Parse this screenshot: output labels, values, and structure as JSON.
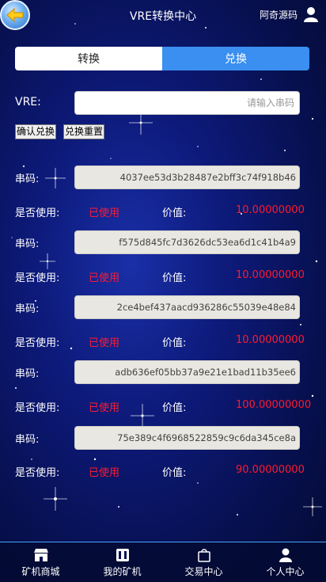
{
  "header": {
    "title": "VRE转换中心",
    "user_label": "阿奇源码"
  },
  "segment": {
    "tab_convert": "转换",
    "tab_redeem": "兑换"
  },
  "redeem_form": {
    "label": "VRE:",
    "placeholder": "请输入串码",
    "confirm_label": "确认兑换",
    "reset_label": "兑换重置"
  },
  "codes": [
    {
      "code_label": "串码:",
      "code": "4037ee53d3b28487e2bff3c74f918b46",
      "used_label": "是否使用:",
      "used": "已使用",
      "value_label": "价值:",
      "value": "10.00000000"
    },
    {
      "code_label": "串码:",
      "code": "f575d845fc7d3626dc53ea6d1c41b4a9",
      "used_label": "是否使用:",
      "used": "已使用",
      "value_label": "价值:",
      "value": "10.00000000"
    },
    {
      "code_label": "串码:",
      "code": "2ce4bef437aacd936286c55039e48e84",
      "used_label": "是否使用:",
      "used": "已使用",
      "value_label": "价值:",
      "value": "10.00000000"
    },
    {
      "code_label": "串码:",
      "code": "adb636ef05bb37a9e21e1bad11b35ee6",
      "used_label": "是否使用:",
      "used": "已使用",
      "value_label": "价值:",
      "value": "100.00000000"
    },
    {
      "code_label": "串码:",
      "code": "75e389c4f6968522859c9c6da345ce8a",
      "used_label": "是否使用:",
      "used": "已使用",
      "value_label": "价值:",
      "value": "90.00000000"
    }
  ],
  "colors": {
    "accent": "#3a8ff0",
    "used_red": "#ff1a2e"
  },
  "bottom_nav": [
    {
      "label": "矿机商城",
      "icon": "store-icon"
    },
    {
      "label": "我的矿机",
      "icon": "miner-icon"
    },
    {
      "label": "交易中心",
      "icon": "bag-icon"
    },
    {
      "label": "个人中心",
      "icon": "person-icon"
    }
  ]
}
